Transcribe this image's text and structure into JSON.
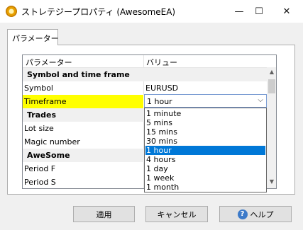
{
  "window": {
    "title": "ストレテジープロパティ (AwesomeEA)",
    "minimize_glyph": "—",
    "maximize_glyph": "☐",
    "close_glyph": "✕",
    "icon": "app-gear-icon"
  },
  "tabs": [
    {
      "label": "パラメーター",
      "active": true
    }
  ],
  "grid": {
    "columns": [
      "パラメーター",
      "バリュー"
    ],
    "rows": [
      {
        "type": "group",
        "name": "Symbol and time frame"
      },
      {
        "type": "param",
        "name": "Symbol",
        "value": "EURUSD"
      },
      {
        "type": "param",
        "name": "Timeframe",
        "value": "1 hour",
        "selected": true
      },
      {
        "type": "group",
        "name": "Trades"
      },
      {
        "type": "param",
        "name": "Lot size",
        "value": ""
      },
      {
        "type": "param",
        "name": "Magic number",
        "value": ""
      },
      {
        "type": "group",
        "name": "AweSome"
      },
      {
        "type": "param",
        "name": "Period F",
        "value": ""
      },
      {
        "type": "param",
        "name": "Period S",
        "value": ""
      }
    ],
    "scroll_up_glyph": "▲",
    "scroll_down_glyph": "▼"
  },
  "combo": {
    "value": "1 hour",
    "arrow_glyph": "⌵"
  },
  "dropdown": {
    "options": [
      "1 minute",
      "5 mins",
      "15 mins",
      "30 mins",
      "1 hour",
      "4 hours",
      "1 day",
      "1 week",
      "1 month"
    ],
    "selected_index": 4
  },
  "buttons": {
    "apply": "適用",
    "cancel": "キャンセル",
    "help": "ヘルプ",
    "help_glyph": "?"
  },
  "colors": {
    "highlight_row": "#ffff00",
    "selection": "#0078d7"
  }
}
